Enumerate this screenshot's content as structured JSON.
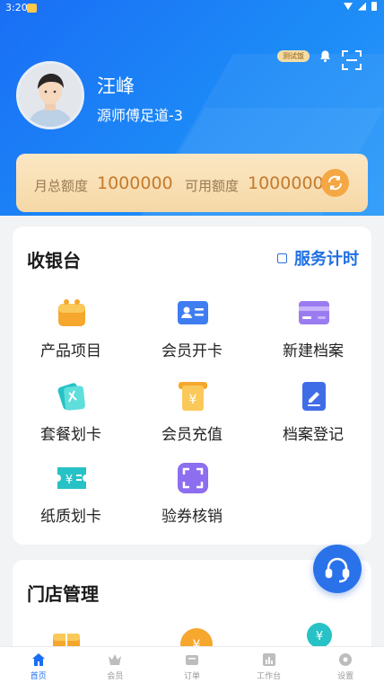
{
  "status_bar": {
    "time": "3:20"
  },
  "header": {
    "test_badge": "测试饭",
    "user_name": "汪峰",
    "shop_name": "源师傅足道-3",
    "icons": {
      "bell": "bell-icon",
      "scan": "scan-icon"
    }
  },
  "quota": {
    "monthly_label": "月总额度",
    "monthly_value": "1000000",
    "available_label": "可用额度",
    "available_value": "1000000"
  },
  "cashier": {
    "title": "收银台",
    "service_timer": "服务计时",
    "items": [
      {
        "label": "产品项目",
        "icon": "product-bag-icon"
      },
      {
        "label": "会员开卡",
        "icon": "member-card-icon"
      },
      {
        "label": "新建档案",
        "icon": "new-file-card-icon"
      },
      {
        "label": "套餐划卡",
        "icon": "package-card-icon"
      },
      {
        "label": "会员充值",
        "icon": "recharge-yuan-icon"
      },
      {
        "label": "档案登记",
        "icon": "register-edit-icon"
      },
      {
        "label": "纸质划卡",
        "icon": "paper-ticket-yuan-icon"
      },
      {
        "label": "验券核销",
        "icon": "coupon-scan-icon"
      }
    ]
  },
  "store": {
    "title": "门店管理"
  },
  "tabs": [
    {
      "label": "首页",
      "icon": "home-icon",
      "active": true
    },
    {
      "label": "会员",
      "icon": "crown-icon",
      "active": false
    },
    {
      "label": "订单",
      "icon": "order-icon",
      "active": false
    },
    {
      "label": "工作台",
      "icon": "workbench-icon",
      "active": false
    },
    {
      "label": "设置",
      "icon": "settings-icon",
      "active": false
    }
  ],
  "colors": {
    "primary": "#1a6ef5",
    "accent": "#f5a743",
    "quota_value": "#c57a2b"
  }
}
